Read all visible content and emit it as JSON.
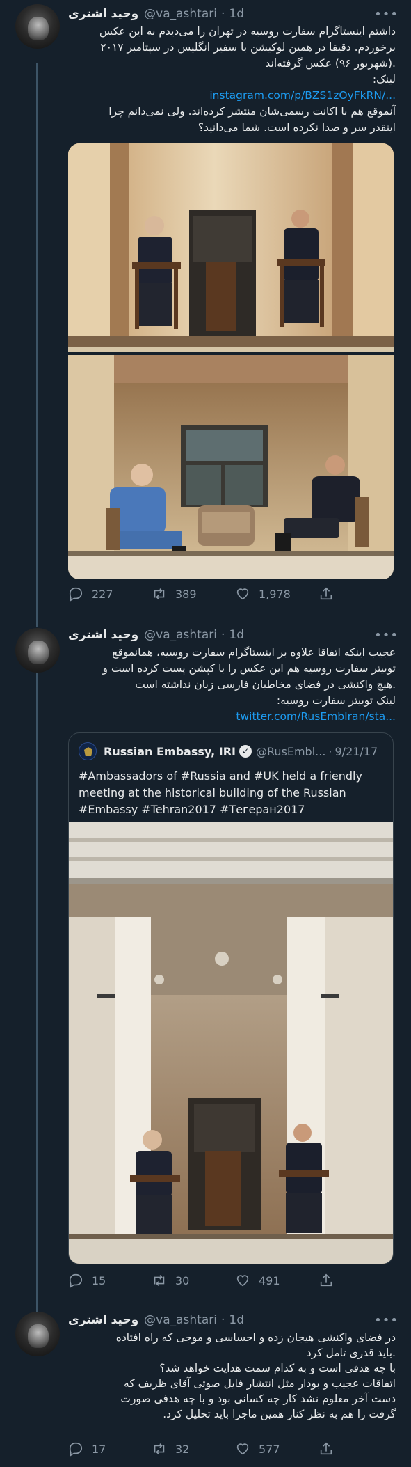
{
  "tweets": [
    {
      "author": {
        "name": "وحید اشتری",
        "handle": "@va_ashtari",
        "dot": "·",
        "time": "1d"
      },
      "more": "•••",
      "text_lines": [
        "داشتم اینستاگرام سفارت روسیه در تهران را می‌دیدم به این عکس",
        "برخوردم. دقیقا در همین لوکیشن با سفیر انگلیس در سپتامبر ۲۰۱۷",
        ".(شهریور ۹۶) عکس گرفته‌اند",
        "لینک:"
      ],
      "link": "instagram.com/p/BZS1zOyFkRN/...",
      "text_lines_2": [
        "آنموقع هم با اکانت رسمی‌شان منتشر کرده‌اند. ولی نمی‌دانم چرا",
        "اینقدر سر و صدا نکرده است. شما می‌دانید؟"
      ],
      "stats": {
        "replies": "227",
        "retweets": "389",
        "likes": "1,978"
      }
    },
    {
      "author": {
        "name": "وحید اشتری",
        "handle": "@va_ashtari",
        "dot": "·",
        "time": "1d"
      },
      "more": "•••",
      "text_lines": [
        "عجیب اینکه اتفاقا علاوه بر اینستاگرام سفارت روسیه، همانموقع",
        "توییتر سفارت روسیه هم این عکس را با کپشن پست کرده است و",
        ".هیچ واکنشی در فضای مخاطبان فارسی زبان نداشته است",
        "لینک توییتر سفارت روسیه:"
      ],
      "link": "twitter.com/RusEmbIran/sta...",
      "quote": {
        "name": "Russian Embassy, IRI",
        "verified": "✓",
        "handle": "@RusEmbl...",
        "dot": "·",
        "time": "9/21/17",
        "text_lines": [
          "#Ambassadors of #Russia and #UK held a friendly",
          "meeting at the historical building of the Russian",
          "#Embassy #Tehran2017 #Тегеран2017"
        ]
      },
      "stats": {
        "replies": "15",
        "retweets": "30",
        "likes": "491"
      }
    },
    {
      "author": {
        "name": "وحید اشتری",
        "handle": "@va_ashtari",
        "dot": "·",
        "time": "1d"
      },
      "more": "•••",
      "text_lines": [
        "در فضای واکنشی هیجان زده و احساسی و موجی که راه افتاده",
        ".باید قدری تامل کرد",
        "با چه هدفی است و به کدام سمت هدایت خواهد شد؟",
        "اتفاقات عجیب و بودار مثل انتشار فایل صوتی آقای ظریف که",
        "دست آخر معلوم نشد کار چه کسانی بود و با چه هدفی صورت",
        "گرفت را هم به نظر کنار همین ماجرا باید تحلیل کرد."
      ],
      "stats": {
        "replies": "17",
        "retweets": "32",
        "likes": "577"
      }
    }
  ],
  "icons": [
    "reply-icon",
    "retweet-icon",
    "like-icon",
    "share-icon"
  ],
  "colors": {
    "background": "#15202b",
    "link": "#1d9bf0",
    "secondary": "#8b98a5",
    "text": "#e7e9ea"
  }
}
